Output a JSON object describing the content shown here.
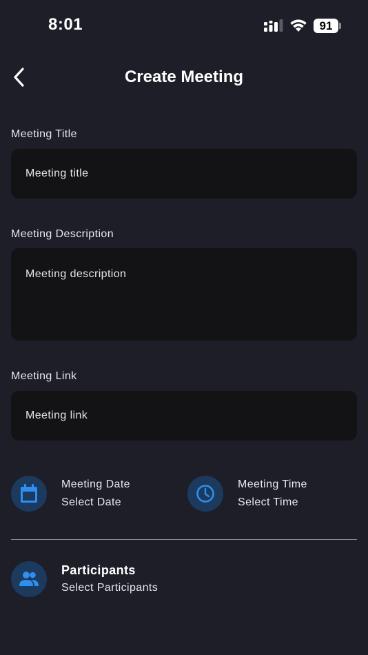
{
  "status_bar": {
    "time": "8:01",
    "battery": "91"
  },
  "header": {
    "title": "Create Meeting",
    "back_icon": "chevron-left-icon"
  },
  "form": {
    "title_field": {
      "label": "Meeting Title",
      "placeholder": "Meeting title"
    },
    "description_field": {
      "label": "Meeting Description",
      "placeholder": "Meeting description"
    },
    "link_field": {
      "label": "Meeting Link",
      "placeholder": "Meeting link"
    }
  },
  "date_picker": {
    "title": "Meeting Date",
    "subtitle": "Select Date",
    "icon": "calendar-icon"
  },
  "time_picker": {
    "title": "Meeting Time",
    "subtitle": "Select Time",
    "icon": "clock-icon"
  },
  "participants": {
    "title": "Participants",
    "subtitle": "Select Participants",
    "icon": "people-icon"
  },
  "colors": {
    "background": "#1e1e29",
    "field_background": "#131316",
    "icon_circle": "#1c3a5e",
    "accent_blue": "#2f8ff0"
  }
}
